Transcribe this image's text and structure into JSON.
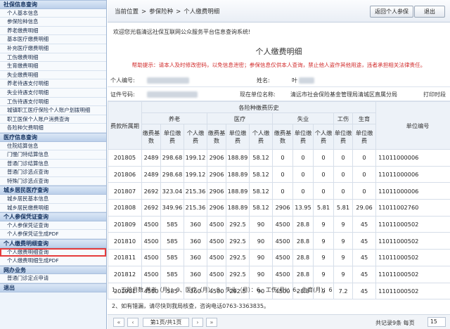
{
  "sidebar": {
    "sections": [
      {
        "title": "社保信息查询",
        "items": [
          "个人基本信息",
          "参保险种信息",
          "养老缴费明细",
          "基本医疗缴费明细",
          "补充医疗缴费明细",
          "工伤缴费明细",
          "生育缴费明细",
          "失业缴费明细",
          "养老待遇支付明细",
          "失业待遇支付明细",
          "工伤待遇支付明细",
          "城镇职工医疗保险个人账户划拨明细",
          "职工医保个人账户消费查询",
          "各险种欠费明细"
        ]
      },
      {
        "title": "医疗信息查询",
        "items": [
          "住院结算信息",
          "门慢门特结算信息",
          "普通门诊结算信息",
          "普通门诊选点查询",
          "特殊门诊选点查询"
        ]
      },
      {
        "title": "城乡居民医疗查询",
        "items": [
          "城乡居民基本信息",
          "城乡居民缴费明细"
        ]
      },
      {
        "title": "个人参保凭证查询",
        "items": [
          "个人参保凭证查询",
          "个人参保凭证生成PDF"
        ]
      },
      {
        "title": "个人缴费明细查询",
        "items": [
          "个人缴费明细查询",
          "个人缴费明细生成PDF"
        ]
      },
      {
        "title": "网办业务",
        "items": [
          "普通门诊定点申请"
        ]
      },
      {
        "title": "退出",
        "items": []
      }
    ],
    "active_item": "个人缴费明细查询"
  },
  "breadcrumb": [
    "当前位置",
    ">",
    "参保险种",
    ">",
    "个人缴费明细"
  ],
  "toolbar": {
    "back_label": "返回个人参保",
    "exit_label": "退出"
  },
  "welcome": "欢迎您光临清远社保互联网公众服务平台信息查询系统!",
  "page_title": "个人缴费明细",
  "tip": "帮助提示：请本人及时修改密码，以免信息泄密；参保信息仅供本人查询，禁止他人盗作其他用途，违者承担相关法律责任。",
  "info": {
    "id_label": "个人编号:",
    "name_label": "姓名:",
    "name_value": "叶",
    "cert_label": "证件号码:",
    "org_label": "现在单位名称:",
    "org_value": "清远市社会保险基金管理局清城区直属分局",
    "print_label": "打印时段"
  },
  "table": {
    "period_header": "费款所属期",
    "group_header": "各险种缴费历史",
    "org_no_header": "单位编号",
    "insurances": [
      "养老",
      "医疗",
      "失业",
      "工伤",
      "生育"
    ],
    "sub_headers": {
      "base": "缴费基数",
      "unit": "单位缴费",
      "person": "个人缴费",
      "unit_short": "单位缴费"
    },
    "rows": [
      [
        "201805",
        "2489",
        "298.68",
        "199.12",
        "2906",
        "188.89",
        "58.12",
        "0",
        "0",
        "0",
        "0",
        "0",
        "11011000006"
      ],
      [
        "201806",
        "2489",
        "298.68",
        "199.12",
        "2906",
        "188.89",
        "58.12",
        "0",
        "0",
        "0",
        "0",
        "0",
        "11011000006"
      ],
      [
        "201807",
        "2692",
        "323.04",
        "215.36",
        "2906",
        "188.89",
        "58.12",
        "0",
        "0",
        "0",
        "0",
        "0",
        "11011000006"
      ],
      [
        "201808",
        "2692",
        "349.96",
        "215.36",
        "2906",
        "188.89",
        "58.12",
        "2906",
        "13.95",
        "5.81",
        "5.81",
        "29.06",
        "11011002760"
      ],
      [
        "201809",
        "4500",
        "585",
        "360",
        "4500",
        "292.5",
        "90",
        "4500",
        "28.8",
        "9",
        "9",
        "45",
        "11011000502"
      ],
      [
        "201810",
        "4500",
        "585",
        "360",
        "4500",
        "292.5",
        "90",
        "4500",
        "28.8",
        "9",
        "9",
        "45",
        "11011000502"
      ],
      [
        "201811",
        "4500",
        "585",
        "360",
        "4500",
        "292.5",
        "90",
        "4500",
        "28.8",
        "9",
        "9",
        "45",
        "11011000502"
      ],
      [
        "201812",
        "4500",
        "585",
        "360",
        "4500",
        "292.5",
        "90",
        "4500",
        "28.8",
        "9",
        "9",
        "45",
        "11011000502"
      ],
      [
        "201901",
        "4500",
        "585",
        "360",
        "4500",
        "292.5",
        "90",
        "4500",
        "28.8",
        "9",
        "7.2",
        "45",
        "11011000502"
      ]
    ]
  },
  "notes": [
    "1、五险月数 养老（月）：9、医疗（月）：9、失业（月）：6、工伤(月)：6、生育(月)：6",
    "2、如有错漏，请尽快到我局核查，咨询电话0763-3363835。"
  ],
  "pager": {
    "first": "«",
    "prev": "‹",
    "page_info": "第1页/共1页",
    "next": "›",
    "last": "»",
    "summary": "共记录9条  每页",
    "page_size": "15"
  }
}
